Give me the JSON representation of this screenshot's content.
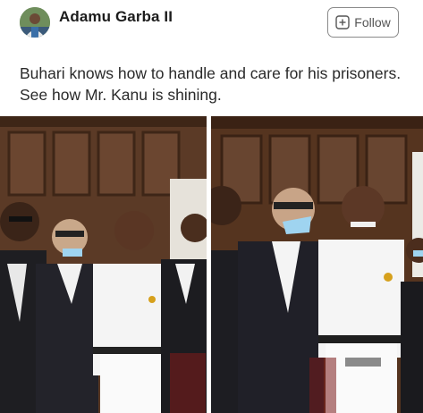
{
  "post": {
    "author_name": "Adamu Garba II",
    "follow_label": "Follow",
    "text": "Buhari knows how to handle and care for his prisoners. See how Mr. Kanu is shining."
  },
  "icons": {
    "avatar": "user-avatar",
    "follow": "plus-box-icon"
  },
  "photos": [
    {
      "id": "courtroom-photo-1"
    },
    {
      "id": "courtroom-photo-2"
    }
  ],
  "colors": {
    "text": "#2a2a2a",
    "follow_border": "#8a8a8a",
    "wood": "#5b3a26"
  }
}
